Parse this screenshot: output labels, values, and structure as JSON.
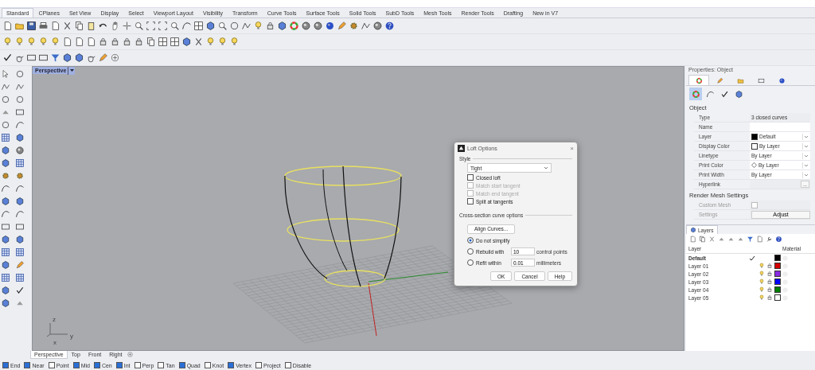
{
  "ribbon_tabs": [
    {
      "label": "Standard",
      "selected": true
    },
    {
      "label": "CPlanes",
      "selected": false
    },
    {
      "label": "Set View",
      "selected": false
    },
    {
      "label": "Display",
      "selected": false
    },
    {
      "label": "Select",
      "selected": false
    },
    {
      "label": "Viewport Layout",
      "selected": false
    },
    {
      "label": "Visibility",
      "selected": false
    },
    {
      "label": "Transform",
      "selected": false
    },
    {
      "label": "Curve Tools",
      "selected": false
    },
    {
      "label": "Surface Tools",
      "selected": false
    },
    {
      "label": "Solid Tools",
      "selected": false
    },
    {
      "label": "SubD Tools",
      "selected": false
    },
    {
      "label": "Mesh Tools",
      "selected": false
    },
    {
      "label": "Render Tools",
      "selected": false
    },
    {
      "label": "Drafting",
      "selected": false
    },
    {
      "label": "New in V7",
      "selected": false
    }
  ],
  "viewport": {
    "title": "Perspective",
    "axis_labels": [
      "z",
      "y",
      "x"
    ]
  },
  "dialog": {
    "title": "Loft Options",
    "close": "×",
    "style_label": "Style",
    "style_value": "Tight",
    "options": [
      {
        "label": "Closed loft",
        "checked": false,
        "disabled": false
      },
      {
        "label": "Match start tangent",
        "checked": false,
        "disabled": true
      },
      {
        "label": "Match end tangent",
        "checked": false,
        "disabled": true
      },
      {
        "label": "Split at tangents",
        "checked": false,
        "disabled": false
      }
    ],
    "cross_section_label": "Cross-section curve options",
    "align_button": "Align Curves...",
    "radios": [
      {
        "label": "Do not simplify",
        "selected": true
      },
      {
        "label": "Rebuild with",
        "selected": false,
        "value": "10",
        "unit": "control points"
      },
      {
        "label": "Refit within",
        "selected": false,
        "value": "0.01",
        "unit": "millimeters"
      }
    ],
    "buttons": [
      "OK",
      "Cancel",
      "Help"
    ]
  },
  "properties": {
    "title": "Properties: Object",
    "tabs": [
      {
        "selected": true
      },
      {
        "selected": false
      },
      {
        "selected": false
      },
      {
        "selected": false
      },
      {
        "selected": false
      }
    ],
    "subtabs": [
      {
        "selected": true
      },
      {
        "selected": false
      },
      {
        "selected": false
      },
      {
        "selected": false
      }
    ],
    "section": "Object",
    "rows": [
      {
        "label": "Type",
        "kind": "text",
        "value": "3 closed curves"
      },
      {
        "label": "Name",
        "kind": "field"
      },
      {
        "label": "Layer",
        "kind": "color-combo",
        "value": "Default",
        "color": "#000000"
      },
      {
        "label": "Display Color",
        "kind": "color-combo",
        "value": "By Layer",
        "color": "#ffffff"
      },
      {
        "label": "Linetype",
        "kind": "combo",
        "value": "By Layer"
      },
      {
        "label": "Print Color",
        "kind": "diamond-combo",
        "value": "By Layer"
      },
      {
        "label": "Print Width",
        "kind": "combo",
        "value": "By Layer"
      },
      {
        "label": "Hyperlink",
        "kind": "browse",
        "value": "..."
      }
    ],
    "mesh_section": "Render Mesh Settings",
    "custom_mesh": {
      "label": "Custom Mesh",
      "checked": false,
      "disabled": true
    },
    "settings": {
      "label": "Settings",
      "button": "Adjust"
    }
  },
  "layers": {
    "title": "Layers",
    "columns": [
      "Layer",
      "Material"
    ],
    "rows": [
      {
        "name": "Default",
        "current": true,
        "color": "#000000"
      },
      {
        "name": "Layer 01",
        "current": false,
        "color": "#d40000"
      },
      {
        "name": "Layer 02",
        "current": false,
        "color": "#8a2be2"
      },
      {
        "name": "Layer 03",
        "current": false,
        "color": "#0000ff"
      },
      {
        "name": "Layer 04",
        "current": false,
        "color": "#008000"
      },
      {
        "name": "Layer 05",
        "current": false,
        "color": "#ffffff"
      }
    ]
  },
  "viewport_tabs": [
    {
      "label": "Perspective",
      "selected": true
    },
    {
      "label": "Top",
      "selected": false
    },
    {
      "label": "Front",
      "selected": false
    },
    {
      "label": "Right",
      "selected": false
    }
  ],
  "osnaps": [
    {
      "label": "End",
      "checked": true
    },
    {
      "label": "Near",
      "checked": true
    },
    {
      "label": "Point",
      "checked": false
    },
    {
      "label": "Mid",
      "checked": true
    },
    {
      "label": "Cen",
      "checked": true
    },
    {
      "label": "Int",
      "checked": true
    },
    {
      "label": "Perp",
      "checked": false
    },
    {
      "label": "Tan",
      "checked": false
    },
    {
      "label": "Quad",
      "checked": true
    },
    {
      "label": "Knot",
      "checked": false
    },
    {
      "label": "Vertex",
      "checked": true
    },
    {
      "label": "Project",
      "checked": false
    },
    {
      "label": "Disable",
      "checked": false
    }
  ]
}
